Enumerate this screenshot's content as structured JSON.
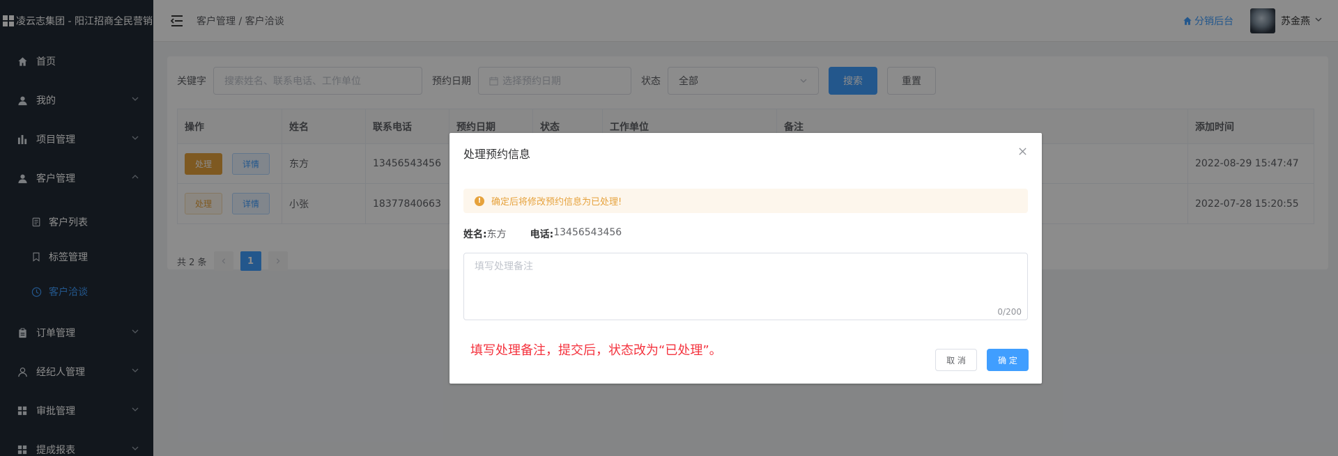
{
  "brand": {
    "title": "凌云志集团 - 阳江招商全民营销"
  },
  "sidebar": {
    "items": [
      {
        "label": "首页",
        "icon": "home-icon"
      },
      {
        "label": "我的",
        "icon": "user-icon"
      },
      {
        "label": "项目管理",
        "icon": "chart-icon"
      },
      {
        "label": "客户管理",
        "icon": "user-icon"
      },
      {
        "label": "订单管理",
        "icon": "clipboard-icon"
      },
      {
        "label": "经纪人管理",
        "icon": "person-icon"
      },
      {
        "label": "审批管理",
        "icon": "grid-icon"
      },
      {
        "label": "提成报表",
        "icon": "grid-icon"
      }
    ],
    "submenu": [
      {
        "label": "客户列表",
        "icon": "document-icon"
      },
      {
        "label": "标签管理",
        "icon": "bookmark-icon"
      },
      {
        "label": "客户洽谈",
        "icon": "clock-icon"
      }
    ]
  },
  "header": {
    "breadcrumb": "客户管理 / 客户洽谈",
    "dist_link": "分销后台",
    "user_name": "苏金燕"
  },
  "filters": {
    "keyword_label": "关键字",
    "keyword_placeholder": "搜索姓名、联系电话、工作单位",
    "date_label": "预约日期",
    "date_placeholder": "选择预约日期",
    "status_label": "状态",
    "status_value": "全部",
    "search_label": "搜索",
    "reset_label": "重置"
  },
  "table": {
    "headers": [
      "操作",
      "姓名",
      "联系电话",
      "预约日期",
      "状态",
      "工作单位",
      "备注",
      "添加时间"
    ],
    "rows": [
      {
        "name": "东方",
        "phone": "13456543456",
        "added": "2022-08-29 15:47:47"
      },
      {
        "name": "小张",
        "phone": "18377840663",
        "added": "2022-07-28 15:20:55"
      }
    ],
    "action_process": "处理",
    "action_detail": "详情"
  },
  "pagination": {
    "total": "共 2 条",
    "current": "1"
  },
  "dialog": {
    "title": "处理预约信息",
    "alert": "确定后将修改预约信息为已处理!",
    "name_label": "姓名:",
    "name_value": "东方",
    "phone_label": "电话:",
    "phone_value": "13456543456",
    "textarea_placeholder": "填写处理备注",
    "counter": "0/200",
    "note": "填写处理备注，提交后，状态改为“已处理”。",
    "cancel_label": "取 消",
    "ok_label": "确 定"
  },
  "colors": {
    "primary": "#409eff",
    "warning": "#e6a23c",
    "sidebar": "#222a35",
    "note": "#f4333e"
  }
}
